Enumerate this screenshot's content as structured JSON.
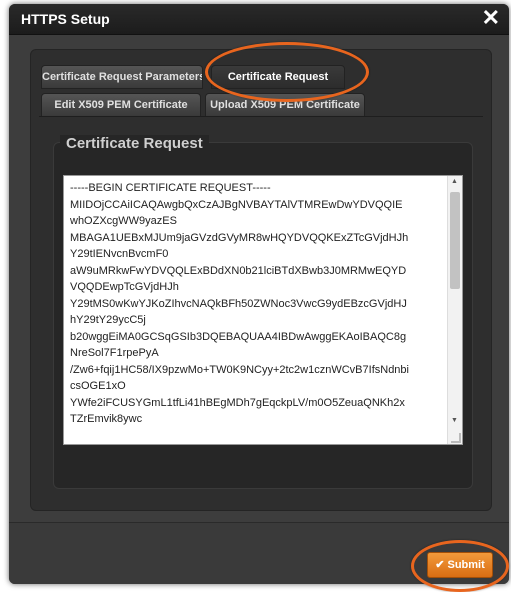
{
  "dialog": {
    "title": "HTTPS Setup",
    "close_symbol": "✕"
  },
  "tabs": [
    {
      "label": "Certificate Request Parameters"
    },
    {
      "label": "Certificate Request"
    },
    {
      "label": "Edit X509 PEM Certificate"
    },
    {
      "label": "Upload X509 PEM Certificate"
    }
  ],
  "section": {
    "legend": "Certificate Request"
  },
  "certificate_lines": [
    "-----BEGIN CERTIFICATE REQUEST-----",
    "MIIDOjCCAiICAQAwgbQxCzAJBgNVBAYTAlVTMREwDwYDVQQIE",
    "whOZXcgWW9yazES",
    "MBAGA1UEBxMJUm9jaGVzdGVyMR8wHQYDVQQKExZTcGVjdHJh",
    "Y29tIENvcnBvcmF0",
    "aW9uMRkwFwYDVQQLExBDdXN0b21lciBTdXBwb3J0MRMwEQYD",
    "VQQDEwpTcGVjdHJh",
    "Y29tMS0wKwYJKoZIhvcNAQkBFh50ZWNoc3VwcG9ydEBzcGVjdHJ",
    "hY29tY29ycC5j",
    "b20wggEiMA0GCSqGSIb3DQEBAQUAA4IBDwAwggEKAoIBAQC8g",
    "NreSol7F1rpePyA",
    "/Zw6+fqij1HC58/IX9pzwMo+TW0K9NCyy+2tc2w1cznWCvB7IfsNdnbi",
    "csOGE1xO",
    "YWfe2iFCUSYGmL1tfLi41hBEgMDh7gEqckpLV/m0O5ZeuaQNKh2x",
    "TZrEmvik8ywc"
  ],
  "footer": {
    "submit_label": "✔ Submit"
  },
  "colors": {
    "accent": "#e8651e",
    "button": "#f08c2c",
    "background": "#3d3d3d"
  }
}
